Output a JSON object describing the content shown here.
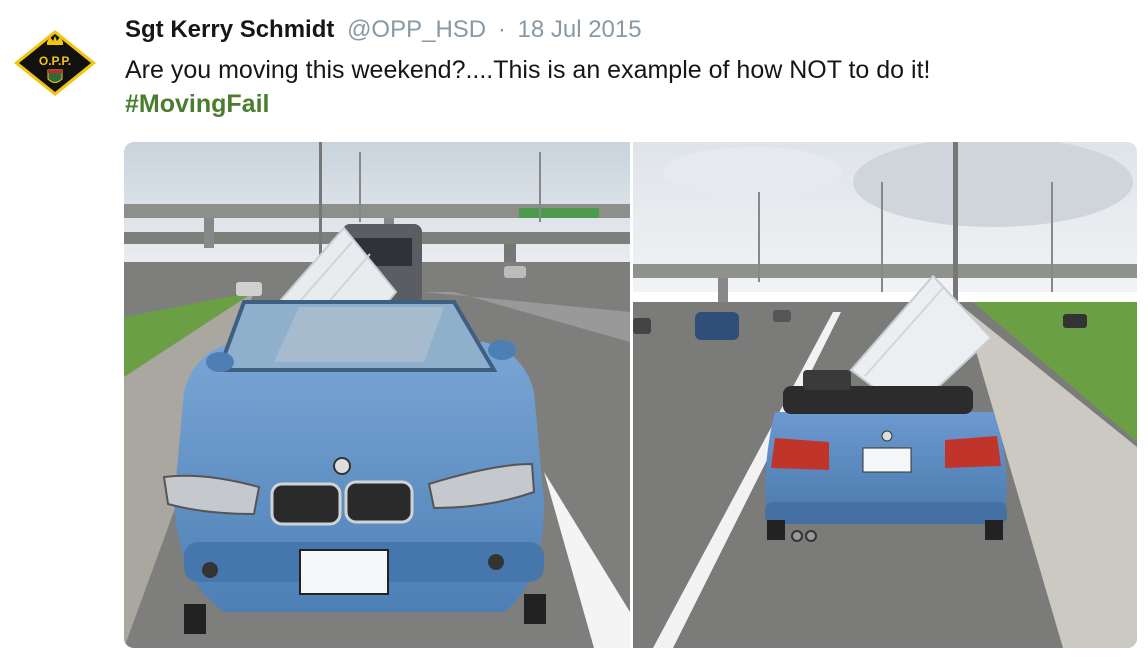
{
  "tweet": {
    "author_name": "Sgt Kerry Schmidt",
    "handle": "@OPP_HSD",
    "separator": "·",
    "date": "18 Jul 2015",
    "text": "Are you moving this weekend?....This is an example of how NOT to do it!",
    "hashtag": "#MovingFail"
  },
  "avatar": {
    "badge_text": "O.P.P.",
    "icon": "opp-badge-icon"
  },
  "media": {
    "photos": [
      {
        "name": "front-view-photo",
        "subject": "blue convertible with mattress, front view"
      },
      {
        "name": "rear-view-photo",
        "subject": "blue convertible with mattress, rear view"
      }
    ]
  },
  "colors": {
    "name": "#14171a",
    "meta": "#8899a6",
    "hashtag": "#4a7d2c",
    "badge_black": "#111111",
    "badge_gold": "#f2c511",
    "car_blue": "#5b8ec4"
  }
}
